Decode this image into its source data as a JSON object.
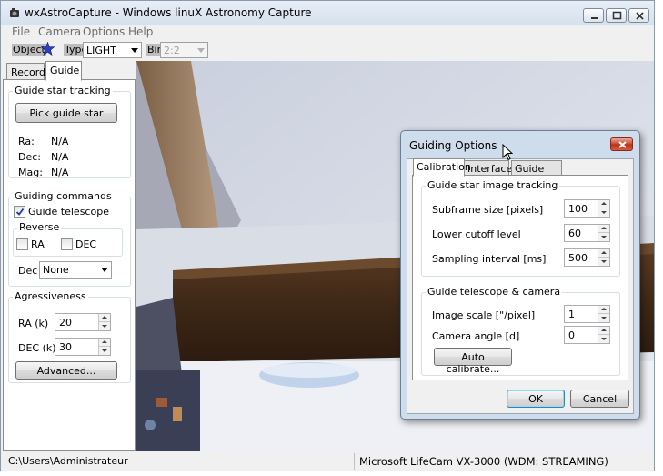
{
  "window": {
    "title": "wxAstroCapture - Windows linuX Astronomy Capture"
  },
  "menu": [
    "File",
    "Camera",
    "Options",
    "Help"
  ],
  "toolbar": {
    "object_label": "Object",
    "type_label": "Type",
    "type_value": "LIGHT",
    "bin_label": "Bin",
    "bin_value": "2:2"
  },
  "tabs": [
    "Record",
    "Guide"
  ],
  "guide_panel": {
    "tracking": {
      "title": "Guide star tracking",
      "pick_button": "Pick guide star",
      "rows": [
        {
          "label": "Ra:",
          "value": "N/A"
        },
        {
          "label": "Dec:",
          "value": "N/A"
        },
        {
          "label": "Mag:",
          "value": "N/A"
        }
      ]
    },
    "commands": {
      "title": "Guiding commands",
      "guide_telescope": "Guide telescope",
      "reverse_title": "Reverse",
      "ra": "RA",
      "dec": "DEC",
      "dec_label": "Dec",
      "dec_value": "None"
    },
    "aggressiveness": {
      "title": "Agressiveness",
      "ra_label": "RA (k)",
      "ra_value": "20",
      "dec_label": "DEC (k)",
      "dec_value": "30",
      "advanced_button": "Advanced..."
    }
  },
  "status": {
    "path": "C:\\Users\\Administrateur",
    "camera": "Microsoft LifeCam VX-3000  (WDM: STREAMING)"
  },
  "dialog": {
    "title": "Guiding Options",
    "tabs": [
      "Calibration",
      "Interface",
      "Guide Port"
    ],
    "tracking_title": "Guide star image tracking",
    "subframe_label": "Subframe size [pixels]",
    "subframe_value": "100",
    "cutoff_label": "Lower cutoff level",
    "cutoff_value": "60",
    "sampling_label": "Sampling interval [ms]",
    "sampling_value": "500",
    "camera_title": "Guide telescope & camera",
    "scale_label": "Image scale [\"/pixel]",
    "scale_value": "1",
    "angle_label": "Camera angle [d]",
    "angle_value": "0",
    "auto_calibrate": "Auto calibrate...",
    "ok": "OK",
    "cancel": "Cancel"
  },
  "colors": {
    "titlebar": "#dce6f1",
    "dialog_frame": "#cfdcec",
    "close_button": "#c7432a"
  }
}
